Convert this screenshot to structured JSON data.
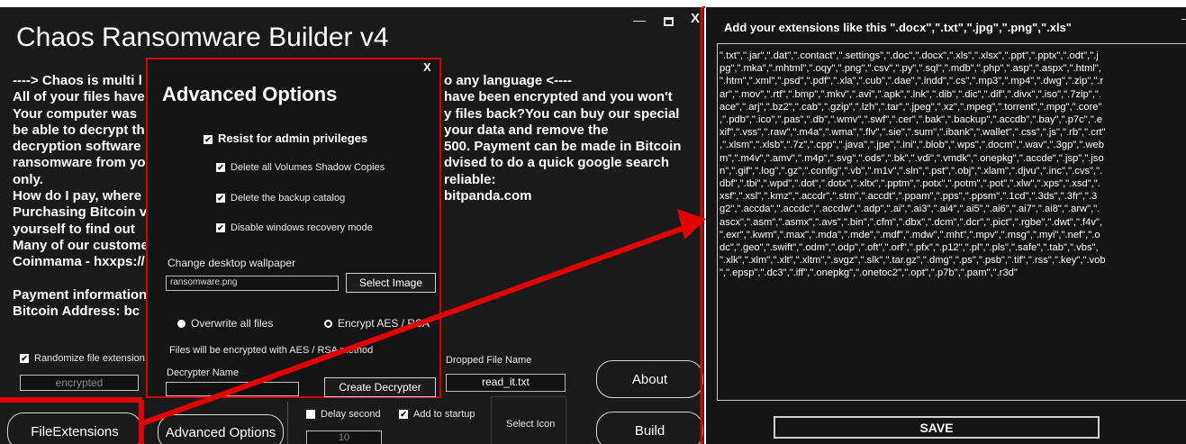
{
  "main_window": {
    "title": "Chaos Ransomware Builder v4",
    "minimize_glyph": "—",
    "close_glyph": "X",
    "message_lines": [
      "----> Chaos is multi l",
      "All of your files have",
      "Your computer was",
      "be able to decrypt th",
      "decryption software",
      "ransomware from yo",
      "only.",
      "How do I pay, where",
      "Purchasing Bitcoin v",
      "yourself  to find out",
      "Many of our custome",
      "Coinmama - hxxps://"
    ],
    "message_right_lines": [
      "o any language <----",
      "",
      "have been encrypted and you won't",
      "y files back?You can buy our special",
      "your data and remove the",
      "500. Payment can be made in Bitcoin",
      "",
      "",
      "dvised to do a quick google search",
      "",
      "reliable:",
      "bitpanda.com"
    ],
    "payment_line": "Payment information",
    "bitcoin_line": "Bitcoin Address:  bc",
    "randomize_label": "Randomize file extension:",
    "extension_value": "encrypted",
    "dropped_label": "Dropped File Name",
    "dropped_value": "read_it.txt",
    "delay_label": "Delay second",
    "delay_value": "10",
    "startup_label": "Add to startup",
    "select_icon_label": "Select Icon",
    "buttons": {
      "file_extensions": "FileExtensions",
      "advanced_options": "Advanced Options",
      "about": "About",
      "build": "Build"
    }
  },
  "advanced_dialog": {
    "title": "Advanced Options",
    "close_glyph": "X",
    "resist_admin": "Resist for admin privileges",
    "delete_shadow": "Delete all Volumes Shadow Copies",
    "delete_backup": "Delete the backup catalog",
    "disable_recovery": "Disable windows recovery mode",
    "wallpaper_label": "Change desktop wallpaper",
    "wallpaper_value": "ransomware.png",
    "select_image": "Select Image",
    "overwrite_label": "Overwrite all files",
    "encrypt_label": "Encrypt  AES / RSA",
    "encrypt_note": "Files will be encrypted with AES / RSA method",
    "decrypter_label": "Decrypter Name",
    "create_decrypter": "Create Decrypter"
  },
  "extensions_window": {
    "heading": "Add your extensions like this     \".docx\",\".txt\",\".jpg\",\".png\",\".xls\"",
    "minimize_glyph": "—",
    "lines": [
      "\".txt\",\".jar\",\".dat\",\".contact\",\".settings\",\".doc\",\".docx\",\".xls\",\".xlsx\",\".ppt\",\".pptx\",\".odt\",\".j",
      "pg\",\".mka\",\".mhtml\",\".oqy\",\".png\",\".csv\",\".py\",\".sql\",\".mdb\",\".php\",\".asp\",\".aspx\",\".html\",",
      "\".htm\",\".xml\",\".psd\",\".pdf\",\".xla\",\".cub\",\".dae\",\".indd\",\".cs\",\".mp3\",\".mp4\",\".dwg\",\".zip\",\".r",
      "ar\",\".mov\",\".rtf\",\".bmp\",\".mkv\",\".avi\",\".apk\",\".lnk\",\".dib\",\".dic\",\".dif\",\".divx\",\".iso\",\".7zip\",\".",
      "ace\",\".arj\",\".bz2\",\".cab\",\".gzip\",\".lzh\",\".tar\",\".jpeg\",\".xz\",\".mpeg\",\".torrent\",\".mpg\",\".core\"",
      ",\".pdb\",\".ico\",\".pas\",\".db\",\".wmv\",\".swf\",\".cer\",\".bak\",\".backup\",\".accdb\",\".bay\",\".p7c\",\".e",
      "xif\",\".vss\",\".raw\",\".m4a\",\".wma\",\".flv\",\".sie\",\".sum\",\".ibank\",\".wallet\",\".css\",\".js\",\".rb\",\".crt\"",
      ",\".xlsm\",\".xlsb\",\".7z\",\".cpp\",\".java\",\".jpe\",\".ini\",\".blob\",\".wps\",\".docm\",\".wav\",\".3gp\",\".web",
      "m\",\".m4v\",\".amv\",\".m4p\",\".svg\",\".ods\",\".bk\",\".vdi\",\".vmdk\",\".onepkg\",\".accde\",\".jsp\",\".jso",
      "n\",\".gif\",\".log\",\".gz\",\".config\",\".vb\",\".m1v\",\".sln\",\".pst\",\".obj\",\".xlam\",\".djvu\",\".inc\",\".cvs\",\".",
      "dbf\",\".tbi\",\".wpd\",\".dot\",\".dotx\",\".xltx\",\".pptm\",\".potx\",\".potm\",\".pot\",\".xlw\",\".xps\",\".xsd\",\".",
      "xsf\",\".xsl\",\".kmz\",\".accdr\",\".stm\",\".accdt\",\".ppam\",\".pps\",\".ppsm\",\".1cd\",\".3ds\",\".3fr\",\".3",
      "g2\",\".accda\",\".accdc\",\".accdw\",\".adp\",\".ai\",\".ai3\",\".ai4\",\".ai5\",\".ai6\",\".ai7\",\".ai8\",\".arw\",\".",
      "ascx\",\".asm\",\".asmx\",\".avs\",\".bin\",\".cfm\",\".dbx\",\".dcm\",\".dcr\",\".pict\",\".rgbe\",\".dwt\",\".f4v\",",
      "\".exr\",\".kwm\",\".max\",\".mda\",\".mde\",\".mdf\",\".mdw\",\".mht\",\".mpv\",\".msg\",\".myi\",\".nef\",\".o",
      "dc\",\".geo\",\".swift\",\".odm\",\".odp\",\".oft\",\".orf\",\".pfx\",\".p12\",\".pl\",\".pls\",\".safe\",\".tab\",\".vbs\",",
      "\".xlk\",\".xlm\",\".xlt\",\".xltm\",\".svgz\",\".slk\",\".tar.gz\",\".dmg\",\".ps\",\".psb\",\".tif\",\".rss\",\".key\",\".vob",
      "\",\".epsp\",\".dc3\",\".iff\",\".onepkg\",\".onetoc2\",\".opt\",\".p7b\",\".pam\",\".r3d\""
    ],
    "save_label": "SAVE"
  },
  "colors": {
    "window_bg": "#1a1a1a",
    "annotation_red": "#e00000",
    "text": "#ffffff"
  }
}
